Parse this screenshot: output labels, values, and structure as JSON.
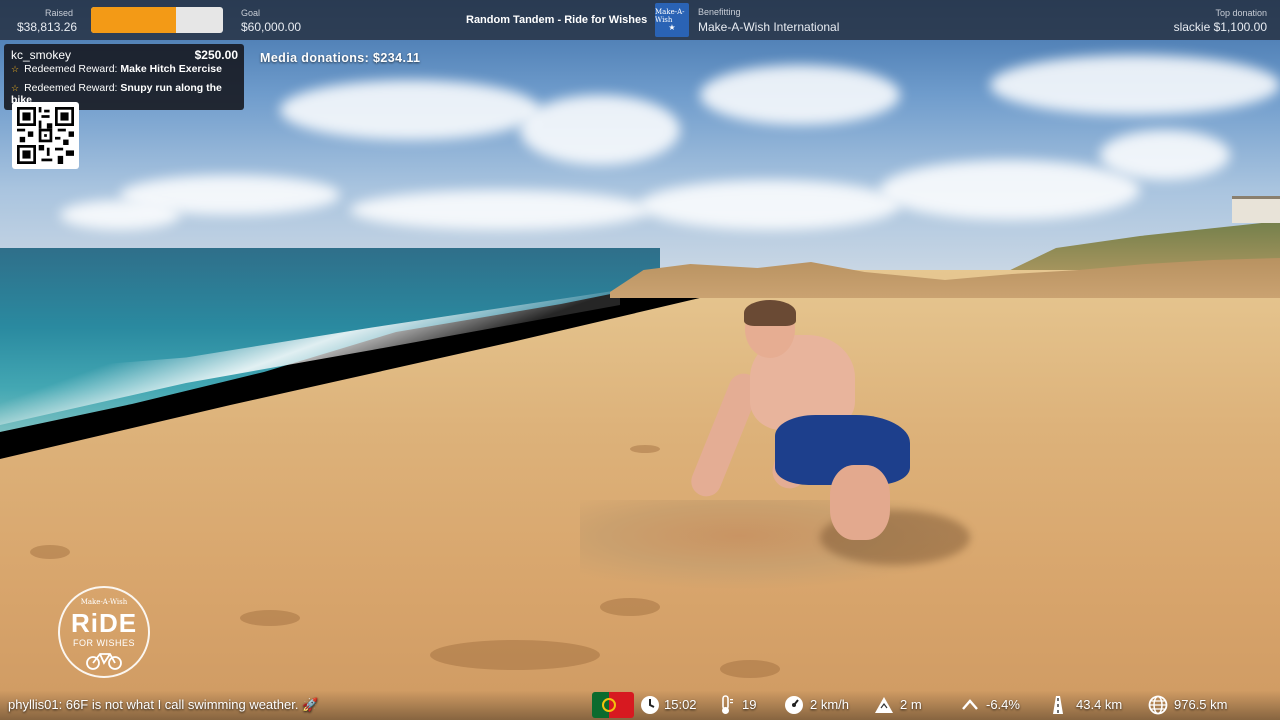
{
  "top_bar": {
    "raised_label": "Raised",
    "raised_value": "$38,813.26",
    "progress_fraction": 0.647,
    "progress_color": "#f39a16",
    "goal_label": "Goal",
    "goal_value": "$60,000.00",
    "stream_title": "Random Tandem - Ride for Wishes",
    "charity_logo_text": "Make-A-Wish",
    "benefitting_label": "Benefitting",
    "benefitting_value": "Make-A-Wish International",
    "top_donation_label": "Top donation",
    "top_donation_value": "slackie $1,100.00"
  },
  "donation_alert": {
    "user": "kc_smokey",
    "amount": "$250.00",
    "rewards": [
      {
        "prefix": "Redeemed Reward: ",
        "name": "Make Hitch Exercise"
      },
      {
        "prefix": "Redeemed Reward: ",
        "name": "Snupy run along the bike"
      }
    ]
  },
  "media_donations": "Media donations: $234.11",
  "ride_logo": {
    "top": "Make-A-Wish",
    "main": "RiDE",
    "sub": "FOR WISHES"
  },
  "chat": {
    "message": "phyllis01: 66F is not what I call swimming weather. 🚀"
  },
  "stats": {
    "time": "15:02",
    "temperature": "19",
    "speed": "2 km/h",
    "altitude": "2 m",
    "slope": "-6.4%",
    "distance_day": "43.4 km",
    "distance_total": "976.5 km"
  },
  "flag_colors": {
    "green": "#0b6b2e",
    "red": "#d71920",
    "emblem": "#f4c20d"
  }
}
